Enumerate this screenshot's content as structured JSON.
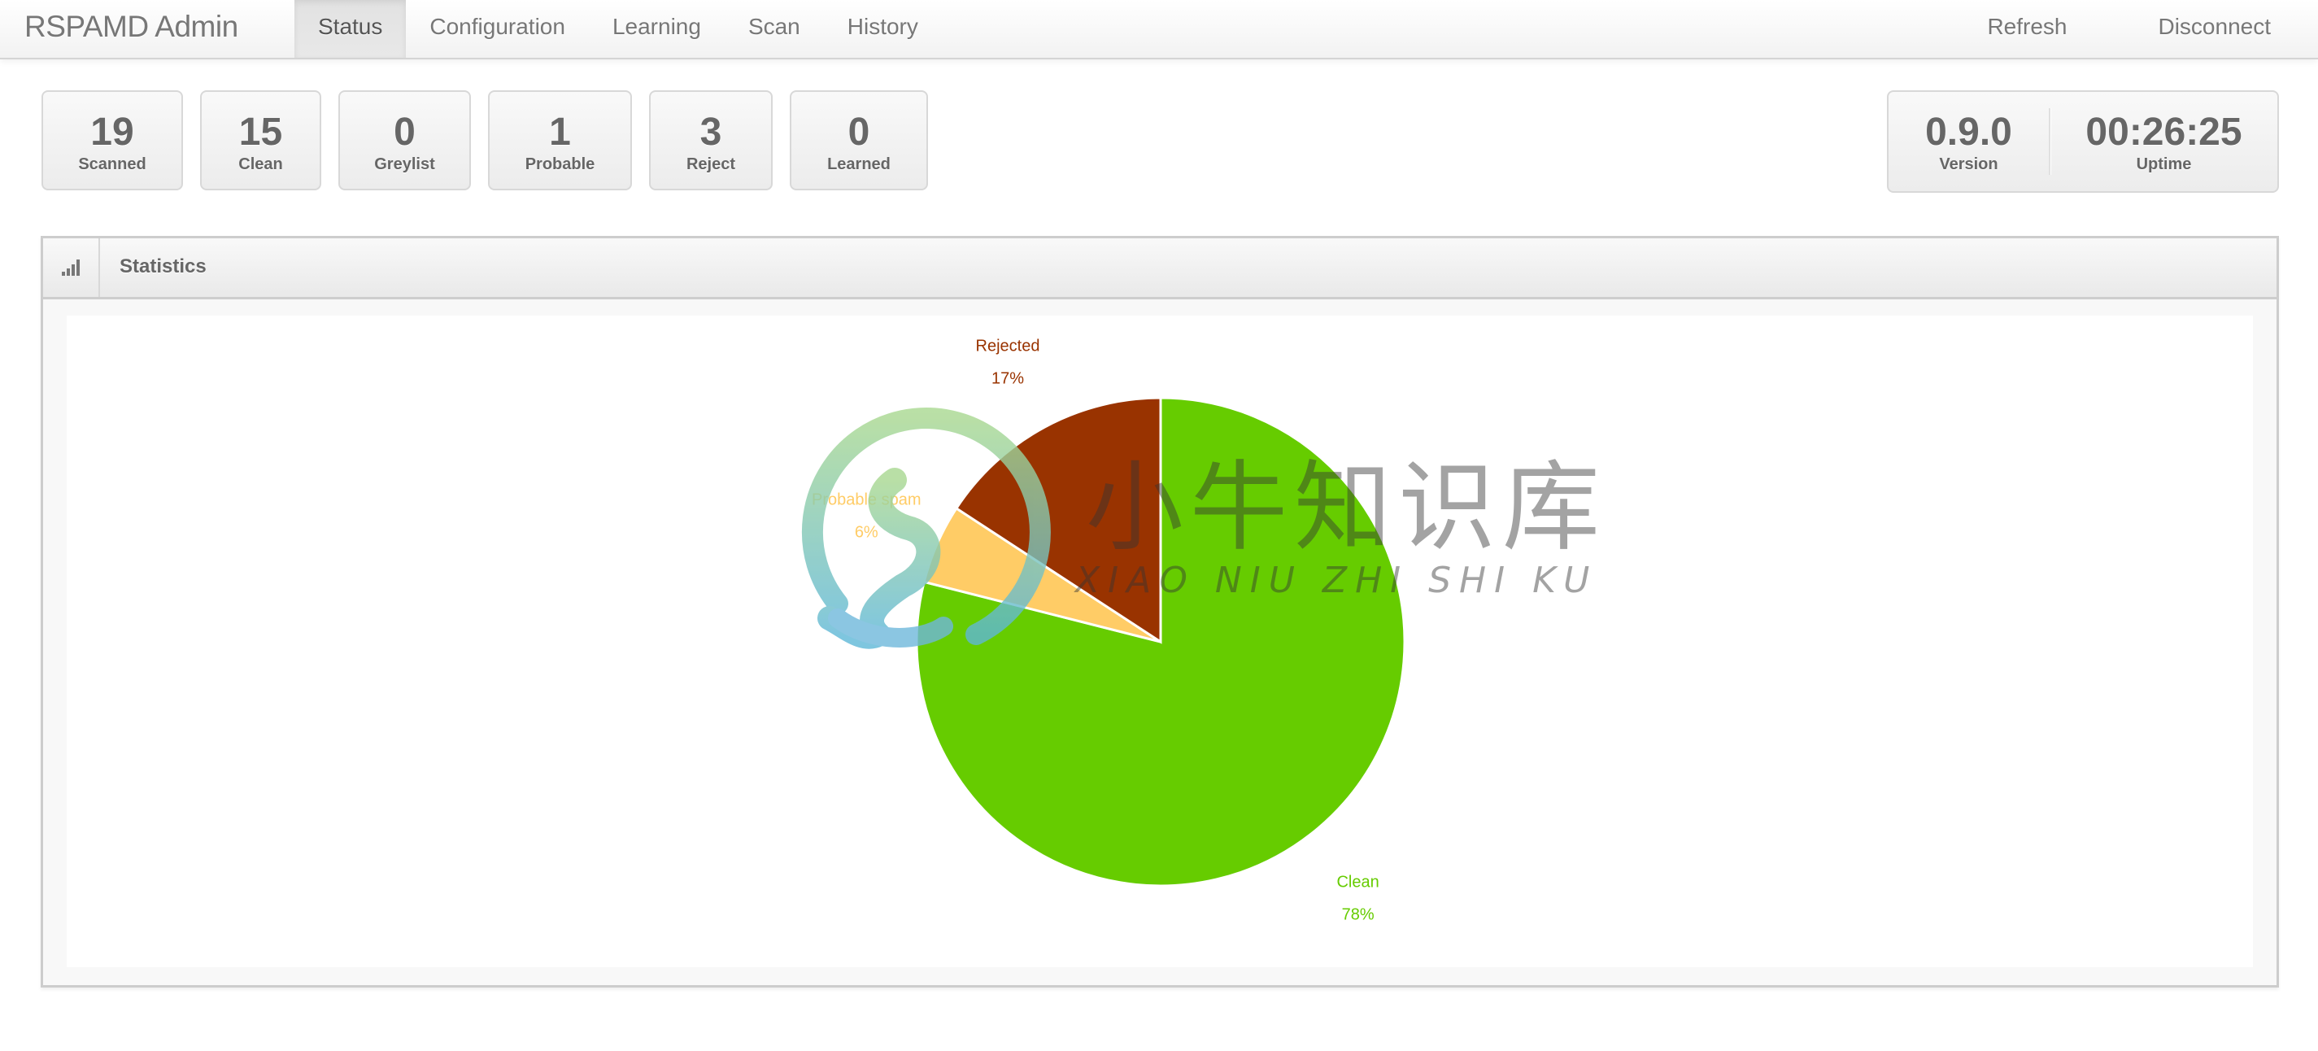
{
  "navbar": {
    "brand": "RSPAMD Admin",
    "tabs": [
      {
        "label": "Status",
        "active": true
      },
      {
        "label": "Configuration",
        "active": false
      },
      {
        "label": "Learning",
        "active": false
      },
      {
        "label": "Scan",
        "active": false
      },
      {
        "label": "History",
        "active": false
      }
    ],
    "actions": [
      {
        "label": "Refresh"
      },
      {
        "label": "Disconnect"
      }
    ]
  },
  "stats": [
    {
      "value": "19",
      "label": "Scanned"
    },
    {
      "value": "15",
      "label": "Clean"
    },
    {
      "value": "0",
      "label": "Greylist"
    },
    {
      "value": "1",
      "label": "Probable"
    },
    {
      "value": "3",
      "label": "Reject"
    },
    {
      "value": "0",
      "label": "Learned"
    }
  ],
  "server": {
    "version": {
      "value": "0.9.0",
      "label": "Version"
    },
    "uptime": {
      "value": "00:26:25",
      "label": "Uptime"
    }
  },
  "panel": {
    "title": "Statistics",
    "icon": "bar-chart-icon"
  },
  "watermark": {
    "text": "小牛知识库",
    "subtext": "XIAO NIU ZHI SHI KU"
  },
  "chart_data": {
    "type": "pie",
    "title": "",
    "start_angle": "top",
    "direction": "clockwise",
    "slices": [
      {
        "name": "Clean",
        "value": 15,
        "label": "78%",
        "color": "#66cc00"
      },
      {
        "name": "Probable spam",
        "value": 1,
        "label": "6%",
        "color": "#ffcc66"
      },
      {
        "name": "Rejected",
        "value": 3,
        "label": "17%",
        "color": "#993300"
      }
    ]
  }
}
